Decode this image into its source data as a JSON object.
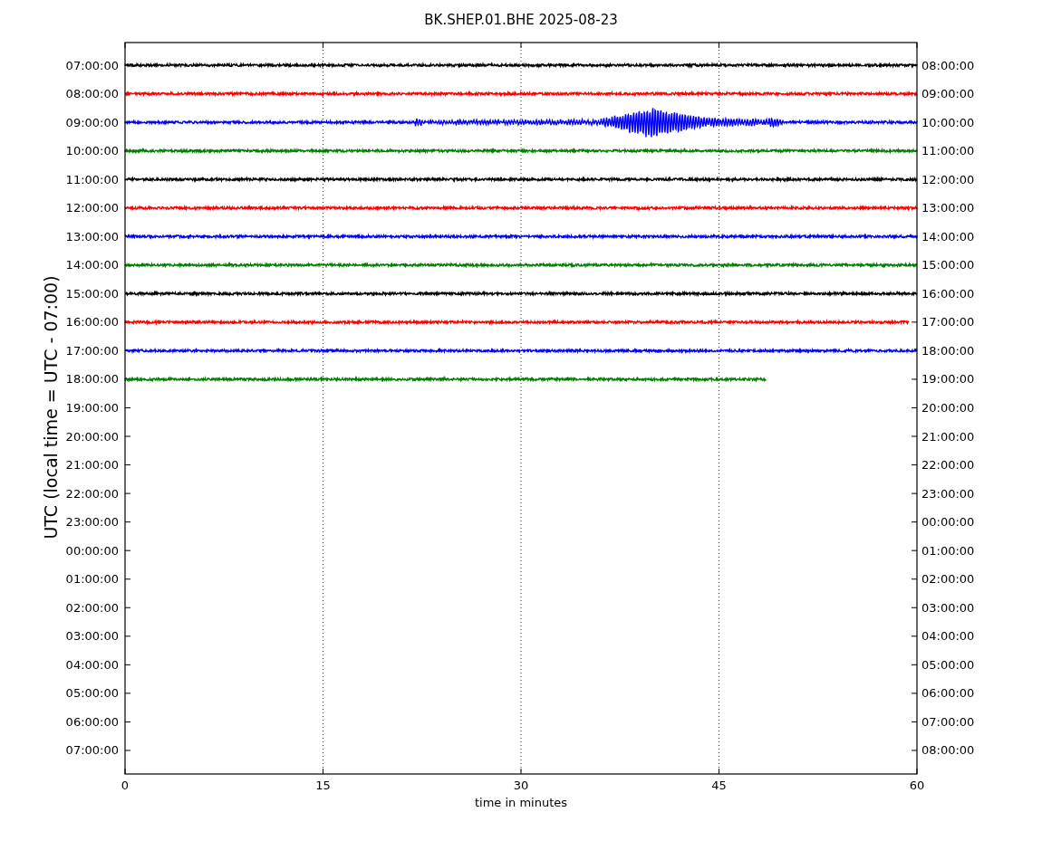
{
  "title": "BK.SHEP.01.BHE 2025-08-23",
  "ylabel": "UTC (local time = UTC - 07:00)",
  "xlabel": "time in minutes",
  "xticks": [
    "0",
    "15",
    "30",
    "45",
    "60"
  ],
  "left_labels": [
    "07:00:00",
    "08:00:00",
    "09:00:00",
    "10:00:00",
    "11:00:00",
    "12:00:00",
    "13:00:00",
    "14:00:00",
    "15:00:00",
    "16:00:00",
    "17:00:00",
    "18:00:00",
    "19:00:00",
    "20:00:00",
    "21:00:00",
    "22:00:00",
    "23:00:00",
    "00:00:00",
    "01:00:00",
    "02:00:00",
    "03:00:00",
    "04:00:00",
    "05:00:00",
    "06:00:00",
    "07:00:00"
  ],
  "right_labels": [
    "08:00:00",
    "09:00:00",
    "10:00:00",
    "11:00:00",
    "12:00:00",
    "13:00:00",
    "14:00:00",
    "15:00:00",
    "16:00:00",
    "17:00:00",
    "18:00:00",
    "19:00:00",
    "20:00:00",
    "21:00:00",
    "22:00:00",
    "23:00:00",
    "00:00:00",
    "01:00:00",
    "02:00:00",
    "03:00:00",
    "04:00:00",
    "05:00:00",
    "06:00:00",
    "07:00:00",
    "08:00:00"
  ],
  "traces": [
    {
      "color": "#000000",
      "level": 1,
      "kind": "noise"
    },
    {
      "color": "#ff0000",
      "level": 1,
      "kind": "noise"
    },
    {
      "color": "#0000ff",
      "level": 1,
      "kind": "event"
    },
    {
      "color": "#008000",
      "level": 1,
      "kind": "noise"
    },
    {
      "color": "#000000",
      "level": 1,
      "kind": "noise"
    },
    {
      "color": "#ff0000",
      "level": 1,
      "kind": "noise"
    },
    {
      "color": "#0000ff",
      "level": 1,
      "kind": "noise"
    },
    {
      "color": "#008000",
      "level": 1,
      "kind": "noise"
    },
    {
      "color": "#000000",
      "level": 1,
      "kind": "noise"
    },
    {
      "color": "#ff0000",
      "level": 0.99,
      "kind": "noise"
    },
    {
      "color": "#0000ff",
      "level": 1,
      "kind": "noise"
    },
    {
      "color": "#008000",
      "level": 0.81,
      "kind": "noise"
    }
  ]
}
